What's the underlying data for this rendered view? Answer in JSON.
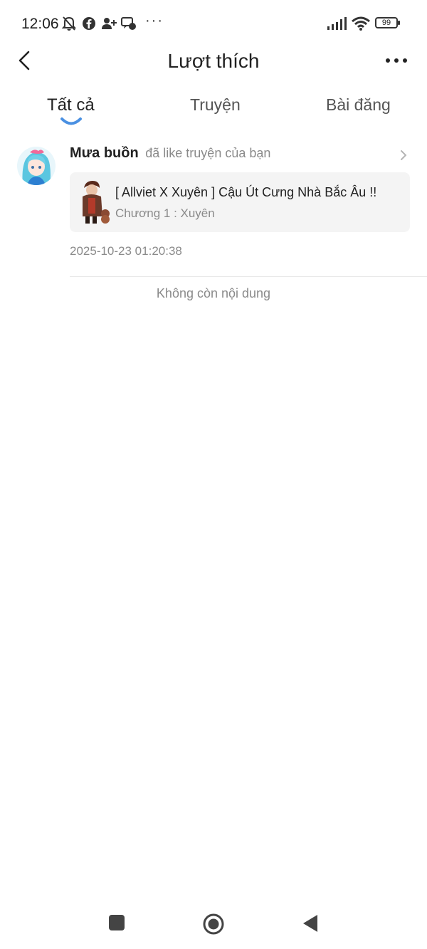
{
  "status_bar": {
    "time": "12:06",
    "battery": "99",
    "left_icons": [
      "bell-off-icon",
      "facebook-icon",
      "person-add-icon",
      "chat-icon"
    ],
    "right_icons": [
      "signal-icon",
      "wifi-icon",
      "battery-icon"
    ]
  },
  "header": {
    "title": "Lượt thích"
  },
  "tabs": [
    {
      "label": "Tất cả",
      "active": true
    },
    {
      "label": "Truyện",
      "active": false
    },
    {
      "label": "Bài đăng",
      "active": false
    }
  ],
  "likes": [
    {
      "user": "Mưa buồn",
      "action": "đã like truyện của bạn",
      "story_title": "[ Allviet X Xuyên ] Cậu Út Cưng Nhà Bắc Âu !!",
      "chapter": "Chương 1 : Xuyên",
      "timestamp": "2025-10-23 01:20:38"
    }
  ],
  "end_message": "Không còn nội dung",
  "colors": {
    "accent": "#4a90e2",
    "muted_text": "#8a8a8a",
    "card_bg": "#f4f4f4"
  }
}
